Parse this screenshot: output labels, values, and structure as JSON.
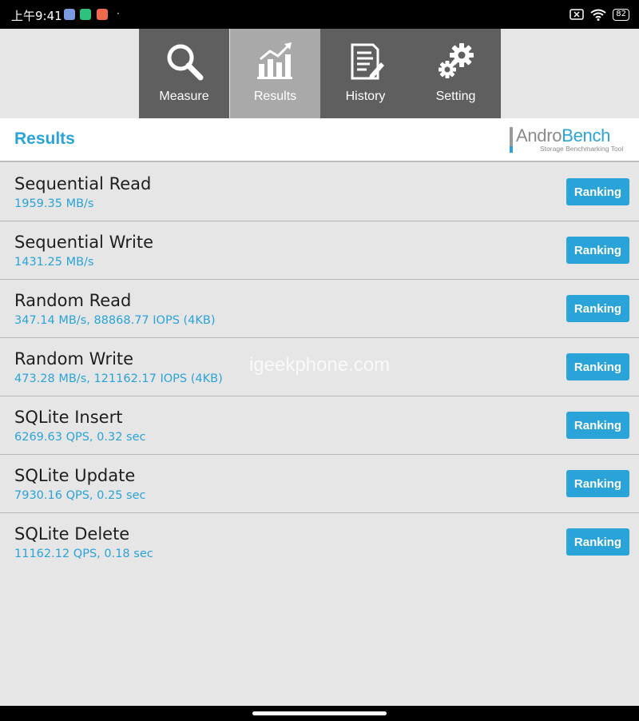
{
  "status_bar": {
    "time": "上午9:41",
    "battery": "82",
    "dot": "·",
    "icons": [
      "app-icon-blue",
      "app-icon-green-shield",
      "app-icon-orange",
      "close-box-icon",
      "wifi-icon",
      "battery-icon"
    ]
  },
  "tabs": [
    {
      "label": "Measure",
      "icon": "search-icon",
      "active": false
    },
    {
      "label": "Results",
      "icon": "chart-icon",
      "active": true
    },
    {
      "label": "History",
      "icon": "document-icon",
      "active": false
    },
    {
      "label": "Setting",
      "icon": "gear-icon",
      "active": false
    }
  ],
  "header": {
    "title": "Results",
    "logo_part1": "Andro",
    "logo_part2": "Bench",
    "logo_tagline": "Storage Benchmarking Tool"
  },
  "results": [
    {
      "name": "Sequential Read",
      "value": "1959.35 MB/s",
      "button": "Ranking"
    },
    {
      "name": "Sequential Write",
      "value": "1431.25 MB/s",
      "button": "Ranking"
    },
    {
      "name": "Random Read",
      "value": "347.14 MB/s, 88868.77 IOPS (4KB)",
      "button": "Ranking"
    },
    {
      "name": "Random Write",
      "value": "473.28 MB/s, 121162.17 IOPS (4KB)",
      "button": "Ranking"
    },
    {
      "name": "SQLite Insert",
      "value": "6269.63 QPS, 0.32 sec",
      "button": "Ranking"
    },
    {
      "name": "SQLite Update",
      "value": "7930.16 QPS, 0.25 sec",
      "button": "Ranking"
    },
    {
      "name": "SQLite Delete",
      "value": "11162.12 QPS, 0.18 sec",
      "button": "Ranking"
    }
  ],
  "watermark": "igeekphone.com",
  "colors": {
    "accent": "#2aa3d8",
    "tab_bg": "#5f5f5f",
    "tab_active": "#a9a9a9",
    "background": "#e6e6e6"
  }
}
